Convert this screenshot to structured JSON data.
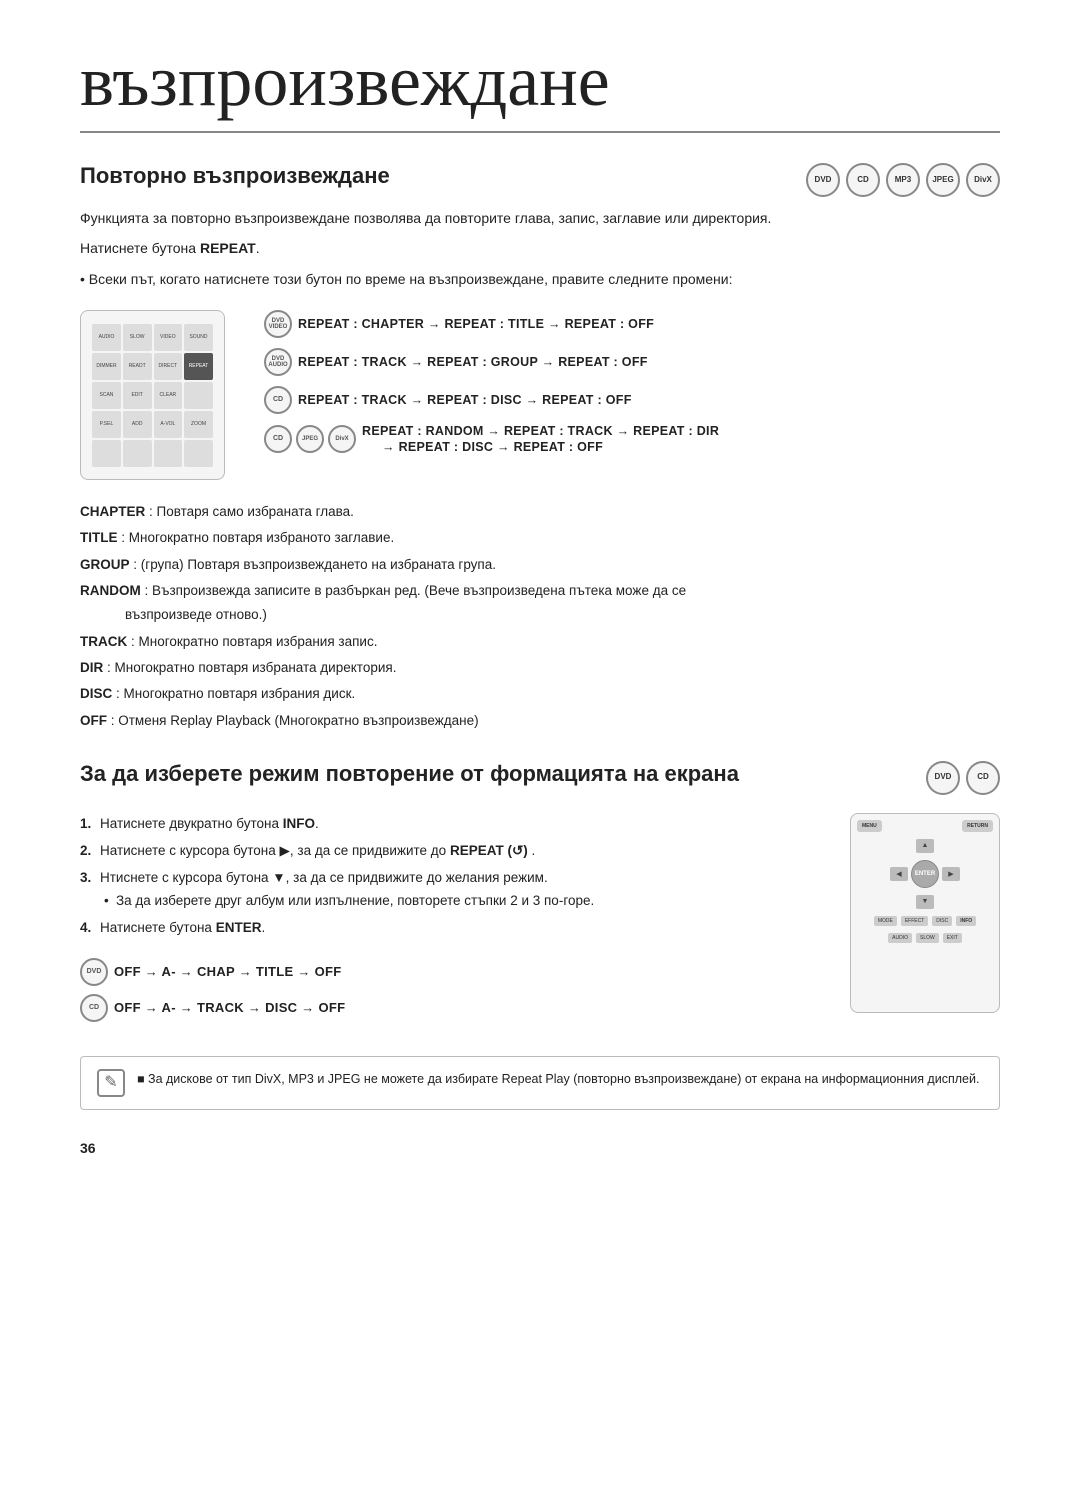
{
  "page": {
    "title": "възпроизвеждане",
    "page_number": "36"
  },
  "section1": {
    "title": "Повторно възпроизвеждане",
    "disc_icons": [
      "DVD",
      "CD",
      "MP3",
      "JPEG",
      "DivX"
    ],
    "intro_text": "Функцията за повторно възпроизвеждане позволява да повторите глава, запис, заглавие или директория.",
    "instruction": "Натиснете бутона REPEAT.",
    "bullet": "Всеки път, когато натиснете този бутон по време на възпроизвеждане, правите следните промени:",
    "sequences": [
      {
        "icons": [
          "DVD-VIDEO"
        ],
        "text": "REPEAT : CHAPTER → REPEAT : TITLE → REPEAT : OFF"
      },
      {
        "icons": [
          "DVD-AUDIO"
        ],
        "text": "REPEAT : TRACK → REPEAT : GROUP → REPEAT : OFF"
      },
      {
        "icons": [
          "CD"
        ],
        "text": "REPEAT : TRACK → REPEAT : DISC → REPEAT : OFF"
      },
      {
        "icons": [
          "CD",
          "JPEG",
          "DivX"
        ],
        "text": "REPEAT : RANDOM → REPEAT : TRACK → REPEAT : DIR → REPEAT : DISC → REPEAT : OFF"
      }
    ],
    "definitions": [
      {
        "term": "CHAPTER",
        "desc": ": Повтаря само избраната глава."
      },
      {
        "term": "TITLE",
        "desc": ": Многократно повтаря избраното заглавие."
      },
      {
        "term": "GROUP",
        "desc": ": (група) Повтаря възпроизвеждането на избраната група."
      },
      {
        "term": "RANDOM",
        "desc": ": Възпроизвежда записите в разбъркан ред. (Вече възпроизведена пътека може да се възпроизведе отново.)"
      },
      {
        "term": "TRACK",
        "desc": ": Многократно повтаря избрания запис."
      },
      {
        "term": "DIR",
        "desc": ": Многократно повтаря избраната директория."
      },
      {
        "term": "DISC",
        "desc": ": Многократно повтаря избрания диск."
      },
      {
        "term": "OFF",
        "desc": ": Отменя Replay Playback (Многократно възпроизвеждане)"
      }
    ]
  },
  "section2": {
    "title": "За да изберете режим повторение от формацията на екрана",
    "disc_icons": [
      "DVD",
      "CD"
    ],
    "steps": [
      {
        "num": "1.",
        "text": "Натиснете двукратно бутона INFO."
      },
      {
        "num": "2.",
        "text": "Натиснете с курсора бутона ▶, за да се придвижите до REPEAT (↺)."
      },
      {
        "num": "3.",
        "text": "Нтиснете с курсора бутона ▼, за да се придвижите до желания режим.",
        "sub": "За да изберете друг албум или изпълнение, повторете стъпки 2 и 3 по-горе."
      },
      {
        "num": "4.",
        "text": "Натиснете бутона ENTER."
      }
    ],
    "off_sequences": [
      {
        "icon": "DVD",
        "text": "OFF → A- → CHAP → TITLE → OFF"
      },
      {
        "icon": "CD",
        "text": "OFF → A- → TRACK → DISC → OFF"
      }
    ]
  },
  "note": {
    "text": "■ За дискове от тип DivX, MP3 и JPEG не можете да избирате Repeat Play (повторно възпроизвеждане) от екрана на информационния дисплей."
  },
  "icons": {
    "note_symbol": "✎"
  }
}
